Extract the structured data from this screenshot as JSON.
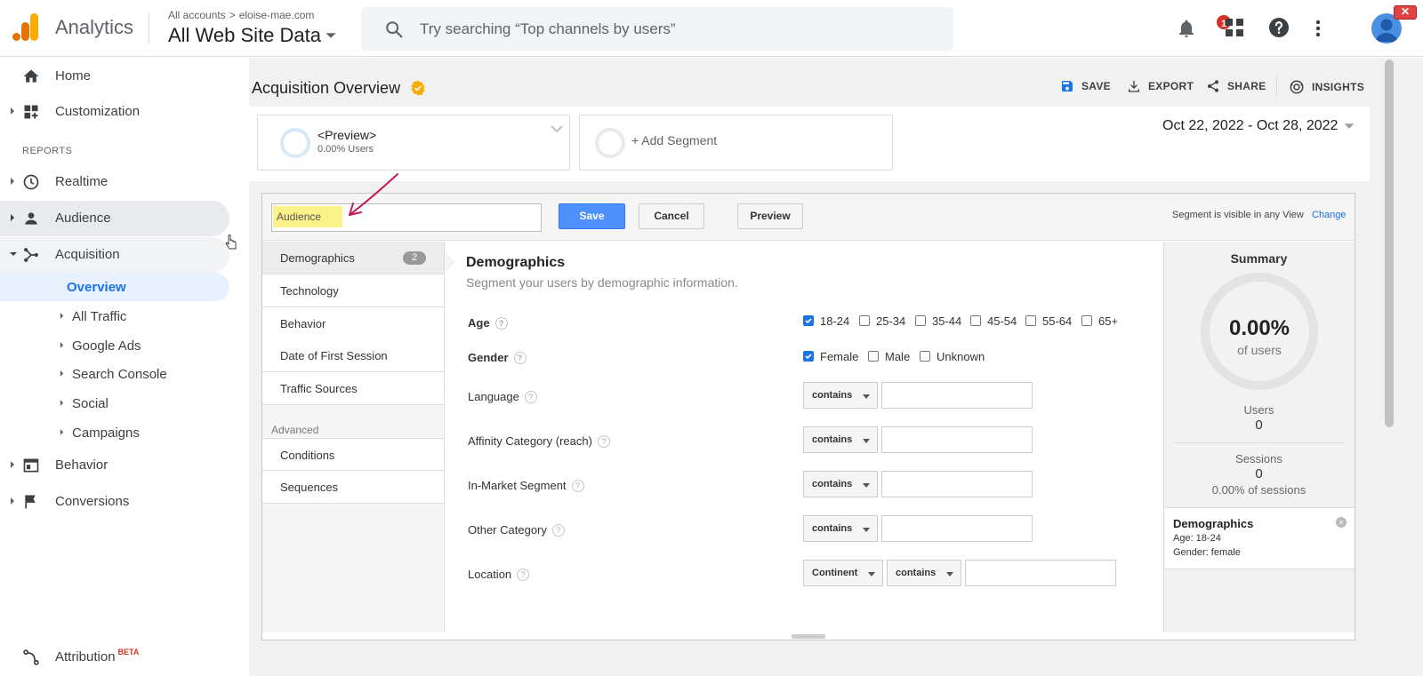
{
  "topbar": {
    "app_name": "Analytics",
    "breadcrumb_all": "All accounts",
    "breadcrumb_sep": ">",
    "breadcrumb_site": "eloise-mae.com",
    "view_name": "All Web Site Data",
    "search_placeholder": "Try searching “Top channels by users”",
    "notification_count": "1",
    "window_close": "✕"
  },
  "sidebar": {
    "home": "Home",
    "customization": "Customization",
    "reports_header": "REPORTS",
    "realtime": "Realtime",
    "audience": "Audience",
    "acquisition": "Acquisition",
    "acquisition_children": [
      "Overview",
      "All Traffic",
      "Google Ads",
      "Search Console",
      "Social",
      "Campaigns"
    ],
    "behavior": "Behavior",
    "conversions": "Conversions",
    "attribution": "Attribution",
    "attribution_badge": "BETA"
  },
  "page": {
    "title": "Acquisition Overview",
    "actions": {
      "save": "SAVE",
      "export": "EXPORT",
      "share": "SHARE",
      "insights": "INSIGHTS"
    },
    "segment_preview_name": "<Preview>",
    "segment_preview_users": "0.00% Users",
    "add_segment": "+ Add Segment",
    "date_range": "Oct 22, 2022 - Oct 28, 2022"
  },
  "editor": {
    "segment_name_value": "Audience",
    "save_button": "Save",
    "cancel_button": "Cancel",
    "preview_button": "Preview",
    "visibility_text": "Segment is visible in any View",
    "change_link": "Change",
    "tabs": [
      "Demographics",
      "Technology",
      "Behavior",
      "Date of First Session",
      "Traffic Sources"
    ],
    "demographics_count": "2",
    "advanced_header": "Advanced",
    "advanced_tabs": [
      "Conditions",
      "Sequences"
    ],
    "section_title": "Demographics",
    "section_subtitle": "Segment your users by demographic information.",
    "age_label": "Age",
    "age_options": [
      {
        "label": "18-24",
        "checked": true
      },
      {
        "label": "25-34",
        "checked": false
      },
      {
        "label": "35-44",
        "checked": false
      },
      {
        "label": "45-54",
        "checked": false
      },
      {
        "label": "55-64",
        "checked": false
      },
      {
        "label": "65+",
        "checked": false
      }
    ],
    "gender_label": "Gender",
    "gender_options": [
      {
        "label": "Female",
        "checked": true
      },
      {
        "label": "Male",
        "checked": false
      },
      {
        "label": "Unknown",
        "checked": false
      }
    ],
    "help_glyph": "?",
    "language_label": "Language",
    "affinity_label": "Affinity Category (reach)",
    "inmarket_label": "In-Market Segment",
    "other_label": "Other Category",
    "location_label": "Location",
    "match_option": "contains",
    "location_scope": "Continent"
  },
  "summary": {
    "title": "Summary",
    "percent": "0.00%",
    "of_users": "of users",
    "users_label": "Users",
    "users_value": "0",
    "sessions_label": "Sessions",
    "sessions_value": "0",
    "sessions_pct": "0.00% of sessions",
    "card_title": "Demographics",
    "card_age": "Age: 18-24",
    "card_gender": "Gender: female",
    "card_remove": "×"
  },
  "colors": {
    "accent_blue": "#1a73e8",
    "save_blue": "#4d90fe",
    "highlight_yellow": "#fdf28a",
    "annotation_arrow": "#c2185b",
    "logo_orange": "#f9ab00",
    "logo_dark_orange": "#e37400"
  }
}
